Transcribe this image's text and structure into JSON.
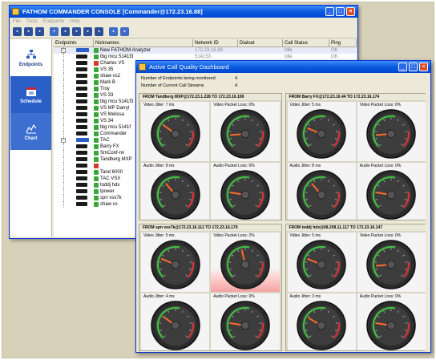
{
  "console": {
    "title": "FATHOM COMMANDER CONSOLE [Commander@172.23.16.88]",
    "menu": [
      "File",
      "Tools",
      "Endpoints",
      "Help"
    ],
    "side": [
      {
        "label": "Endpoints"
      },
      {
        "label": "Schedule"
      },
      {
        "label": "Chart"
      }
    ],
    "columns": [
      "Endpoints",
      "Nicknames",
      "Network ID",
      "Dialout",
      "Call Status",
      "Ping"
    ],
    "rows": [
      {
        "nick": "New FATHOM Analyzer",
        "net": "172.23.16.89",
        "status": "Idle",
        "ping": "OK",
        "color": "#3aa63a"
      },
      {
        "nick": "tbg mcu 5141f3",
        "net": "514153",
        "status": "Idle",
        "ping": "OK",
        "color": "#3aa63a"
      },
      {
        "nick": "Charles VS",
        "net": "",
        "status": "",
        "ping": "",
        "color": "#d33a2c"
      },
      {
        "nick": "VS 35",
        "net": "",
        "status": "",
        "ping": "",
        "color": "#3aa63a"
      },
      {
        "nick": "shaw vs2",
        "net": "",
        "status": "",
        "ping": "",
        "color": "#3aa63a"
      },
      {
        "nick": "Mark B",
        "net": "",
        "status": "",
        "ping": "",
        "color": "#3aa63a"
      },
      {
        "nick": "Troy",
        "net": "",
        "status": "",
        "ping": "",
        "color": "#3aa63a"
      },
      {
        "nick": "VS 33",
        "net": "",
        "status": "",
        "ping": "",
        "color": "#3aa63a"
      },
      {
        "nick": "tbg mcu 5141f3",
        "net": "",
        "status": "",
        "ping": "",
        "color": "#3aa63a"
      },
      {
        "nick": "VS MP Darryl",
        "net": "",
        "status": "",
        "ping": "",
        "color": "#3aa63a"
      },
      {
        "nick": "VS Melissa",
        "net": "",
        "status": "",
        "ping": "",
        "color": "#3aa63a"
      },
      {
        "nick": "VS 34",
        "net": "",
        "status": "",
        "ping": "",
        "color": "#3aa63a"
      },
      {
        "nick": "tbg mcu 5141f",
        "net": "",
        "status": "",
        "ping": "",
        "color": "#3aa63a"
      },
      {
        "nick": "Commander",
        "net": "",
        "status": "",
        "ping": "",
        "color": "#3aa63a"
      },
      {
        "nick": "TAC",
        "net": "",
        "status": "",
        "ping": "",
        "color": "#3aa63a"
      },
      {
        "nick": "Barry FX",
        "net": "",
        "status": "",
        "ping": "",
        "color": "#3aa63a"
      },
      {
        "nick": "SmConf-nn",
        "net": "",
        "status": "",
        "ping": "",
        "color": "#3aa63a"
      },
      {
        "nick": "Tandberg MXP",
        "net": "",
        "status": "",
        "ping": "",
        "color": "#3aa63a"
      },
      {
        "nick": "",
        "net": "",
        "status": "",
        "ping": "",
        "color": "#d33a2c"
      },
      {
        "nick": "Tand 6000",
        "net": "",
        "status": "",
        "ping": "",
        "color": "#3aa63a"
      },
      {
        "nick": "TAC VSX",
        "net": "",
        "status": "",
        "ping": "",
        "color": "#3aa63a"
      },
      {
        "nick": "toddj hdx",
        "net": "",
        "status": "",
        "ping": "",
        "color": "#3aa63a"
      },
      {
        "nick": "lpower",
        "net": "",
        "status": "",
        "ping": "",
        "color": "#3aa63a"
      },
      {
        "nick": "spn vsx7k",
        "net": "",
        "status": "",
        "ping": "",
        "color": "#3aa63a"
      },
      {
        "nick": "shaw vs",
        "net": "",
        "status": "",
        "ping": "",
        "color": "#3aa63a"
      }
    ]
  },
  "dashboard": {
    "title": "Active Call Quality Dashboard",
    "endpoints_label": "Number of Endpoints being monitored",
    "endpoints_value": "4",
    "streams_label": "Number of Current Call Streams",
    "streams_value": "4",
    "panels": [
      {
        "title": "FROM Tandberg MXP@172.23.1.228 TO 172.23.16.169",
        "cells": [
          "Video Jitter: 7 ms",
          "Video Packet Loss: 0%",
          "Audio Jitter: 8 ms",
          "Audio Packet Loss: 0%"
        ]
      },
      {
        "title": "FROM Barry FX@172.23.16.44 TO 172.23.16.174",
        "cells": [
          "Video Jitter: 5 ms",
          "Video Packet Loss: 0%",
          "Audio Jitter: 8 ms",
          "Audio Packet Loss: 0%"
        ]
      },
      {
        "title": "FROM spn vsx7k@172.23.16.112 TO 172.23.16.179",
        "cells": [
          "Video Jitter: 5 ms",
          "Video Packet Loss: 2%",
          "Audio Jitter: 4 ms",
          "Audio Packet Loss: 0%"
        ]
      },
      {
        "title": "FROM toddj hdx@68.208.11.117 TO 172.23.16.147",
        "cells": [
          "Video Jitter: 5 ms",
          "Video Packet Loss: 0%",
          "Audio Jitter: 3 ms",
          "Audio Packet Loss: 0%"
        ]
      }
    ],
    "needles": [
      [
        0.3,
        0.15,
        0.35,
        0.2
      ],
      [
        0.25,
        0.15,
        0.35,
        0.2
      ],
      [
        0.25,
        0.45,
        0.3,
        0.2
      ],
      [
        0.25,
        0.15,
        0.28,
        0.2
      ]
    ]
  }
}
